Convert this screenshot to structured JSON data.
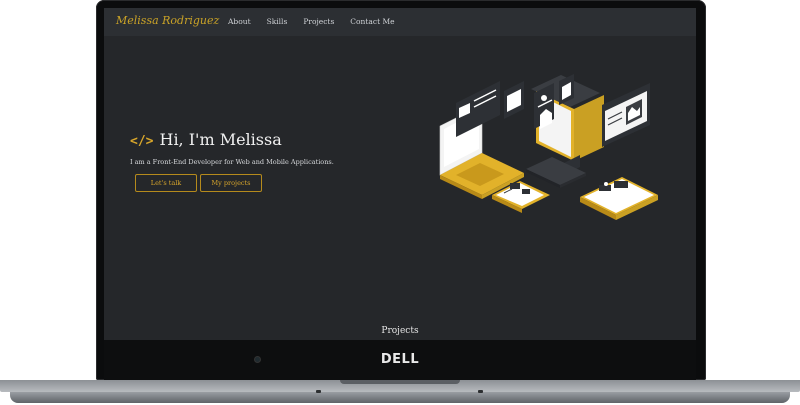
{
  "nav": {
    "logo": "Melissa Rodriguez",
    "links": [
      "About",
      "Skills",
      "Projects",
      "Contact Me"
    ]
  },
  "hero": {
    "code_symbol": "</>",
    "title": "Hi, I'm Melissa",
    "subtitle": "I am a Front-End Developer for Web and Mobile Applications.",
    "buttons": {
      "talk": "Let's talk",
      "projects": "My projects"
    }
  },
  "sections": {
    "projects_heading": "Projects"
  },
  "device": {
    "brand": "DELL"
  },
  "colors": {
    "accent": "#d8a62b",
    "background": "#25272a",
    "nav": "#2c2f33"
  }
}
